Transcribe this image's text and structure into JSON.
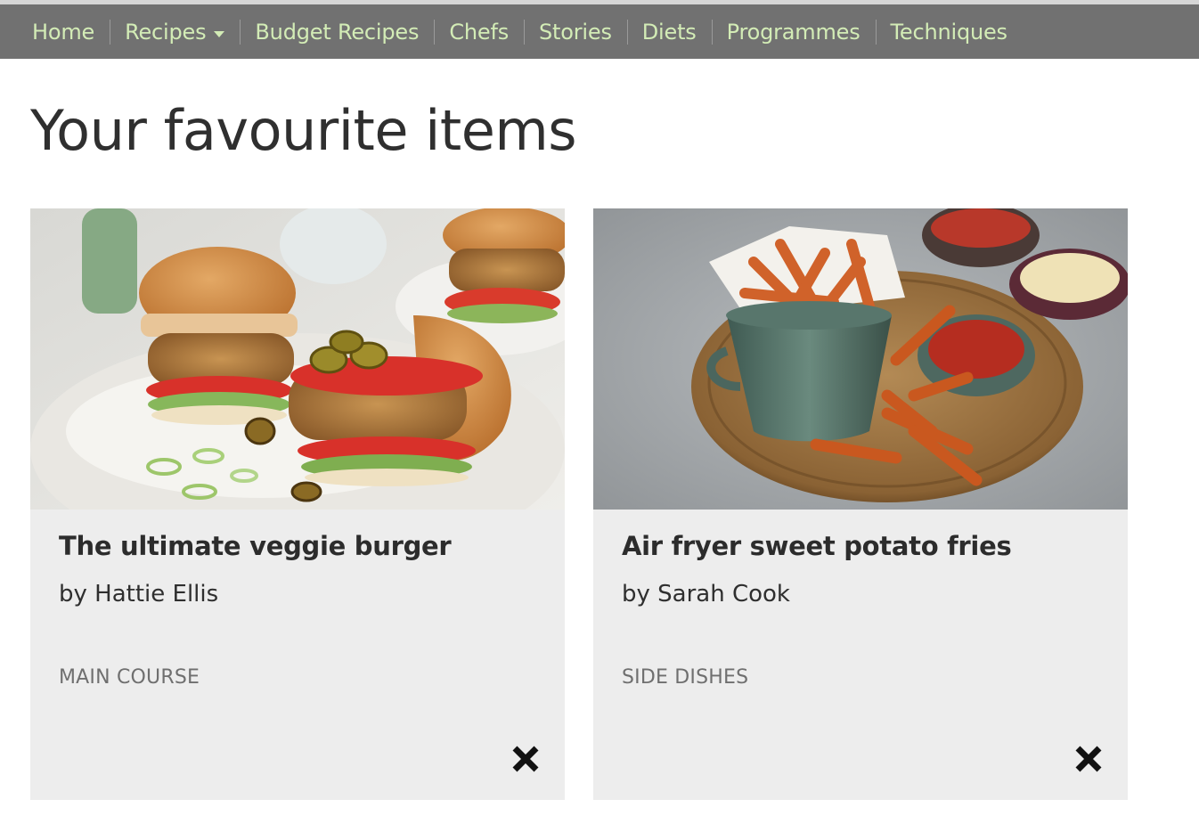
{
  "nav": {
    "items": [
      {
        "label": "Home"
      },
      {
        "label": "Recipes",
        "has_dropdown": true
      },
      {
        "label": "Budget Recipes"
      },
      {
        "label": "Chefs"
      },
      {
        "label": "Stories"
      },
      {
        "label": "Diets"
      },
      {
        "label": "Programmes"
      },
      {
        "label": "Techniques"
      }
    ]
  },
  "page": {
    "title": "Your favourite items"
  },
  "cards": [
    {
      "title": "The ultimate veggie burger",
      "author": "by Hattie Ellis",
      "category": "MAIN COURSE",
      "image": "veggie burgers with tomato and jalapeños",
      "remove_icon": "close-icon"
    },
    {
      "title": "Air fryer sweet potato fries",
      "author": "by Sarah Cook",
      "category": "SIDE DISHES",
      "image": "sweet potato fries in a bucket with dips",
      "remove_icon": "close-icon"
    }
  ],
  "colors": {
    "nav_background": "#717171",
    "nav_link": "#d3ecb6",
    "card_background": "#ededed"
  }
}
